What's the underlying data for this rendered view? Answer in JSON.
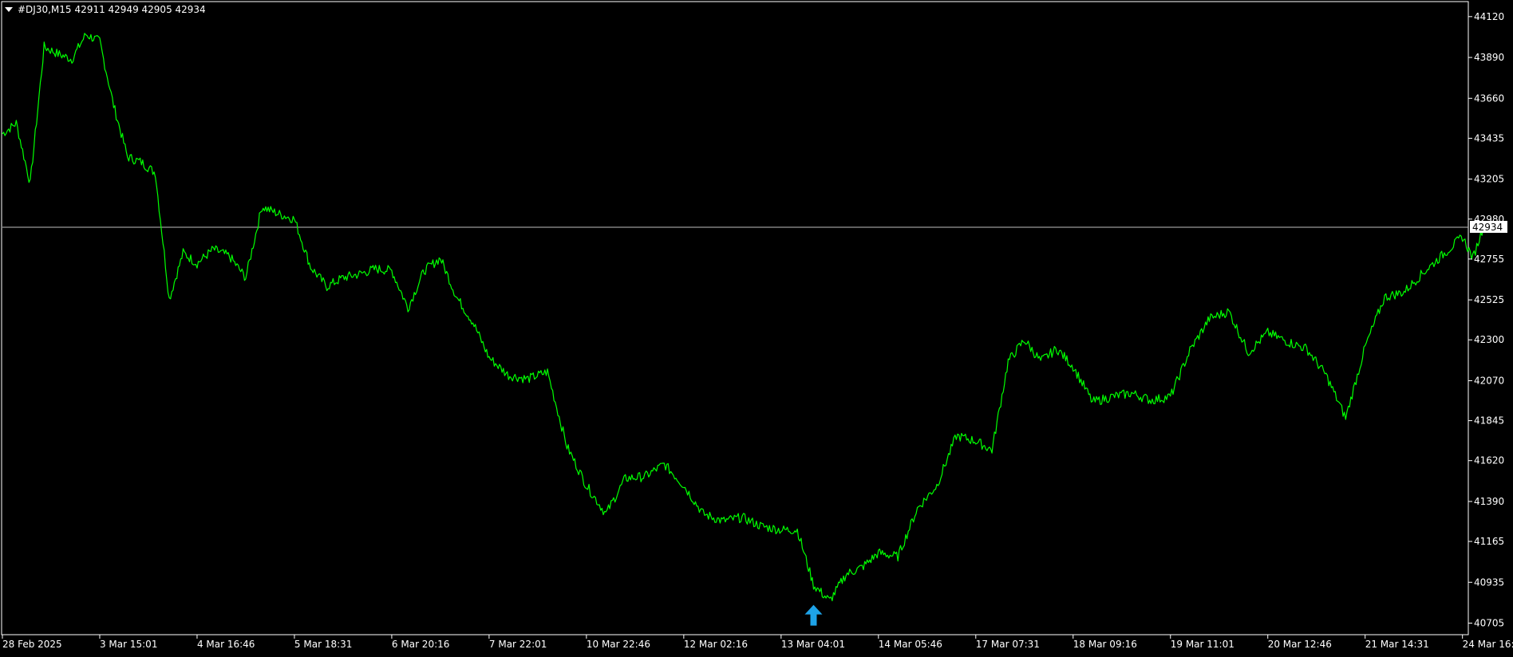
{
  "header": {
    "symbol": "#DJ30,M15",
    "ohlc": "42911 42949 42905 42934"
  },
  "price_line": {
    "value": 42934,
    "label": "42934",
    "color": "#c0c0c0"
  },
  "signal": {
    "type": "buy-arrow",
    "color": "#1ea3e8",
    "x": "13 Mar 11:30",
    "y": 40745
  },
  "colors": {
    "background": "#000000",
    "line": "#00ff00",
    "axis": "#ffffff",
    "text": "#ffffff"
  },
  "chart_data": {
    "type": "line",
    "title": "#DJ30,M15",
    "xlabel": "",
    "ylabel": "",
    "ylim": [
      40640,
      44200
    ],
    "yticks": [
      44120,
      43890,
      43660,
      43435,
      43205,
      42980,
      42755,
      42525,
      42300,
      42070,
      41845,
      41620,
      41390,
      41165,
      40935,
      40705
    ],
    "xticks": [
      "28 Feb 2025",
      "3 Mar 15:01",
      "4 Mar 16:46",
      "5 Mar 18:31",
      "6 Mar 20:16",
      "7 Mar 22:01",
      "10 Mar 22:46",
      "12 Mar 02:16",
      "13 Mar 04:01",
      "14 Mar 05:46",
      "17 Mar 07:31",
      "18 Mar 09:16",
      "19 Mar 11:01",
      "20 Mar 12:46",
      "21 Mar 14:31",
      "24 Mar 16:16"
    ],
    "grid": false,
    "series": [
      {
        "color": "#00ff00",
        "x": [
          "28 Feb 2025",
          "28 Feb 12:00",
          "28 Feb 16:00",
          "28 Feb 20:00",
          "3 Mar 04:00",
          "3 Mar 09:00",
          "3 Mar 12:00",
          "3 Mar 15:01",
          "3 Mar 19:00",
          "3 Mar 23:00",
          "4 Mar 04:00",
          "4 Mar 09:00",
          "4 Mar 12:00",
          "4 Mar 15:00",
          "4 Mar 16:46",
          "4 Mar 21:00",
          "5 Mar 02:00",
          "5 Mar 06:00",
          "5 Mar 10:00",
          "5 Mar 14:00",
          "5 Mar 18:31",
          "5 Mar 22:00",
          "6 Mar 03:00",
          "6 Mar 07:00",
          "6 Mar 11:00",
          "6 Mar 16:00",
          "6 Mar 20:16",
          "7 Mar 02:00",
          "7 Mar 06:00",
          "7 Mar 10:00",
          "7 Mar 14:00",
          "7 Mar 18:00",
          "7 Mar 22:01",
          "10 Mar 03:00",
          "10 Mar 08:00",
          "10 Mar 13:00",
          "10 Mar 18:00",
          "10 Mar 22:46",
          "11 Mar 04:00",
          "11 Mar 09:00",
          "11 Mar 14:00",
          "11 Mar 20:00",
          "12 Mar 02:16",
          "12 Mar 07:00",
          "12 Mar 12:00",
          "12 Mar 17:00",
          "12 Mar 22:00",
          "13 Mar 04:01",
          "13 Mar 08:00",
          "13 Mar 11:30",
          "13 Mar 15:00",
          "13 Mar 20:00",
          "14 Mar 01:00",
          "14 Mar 05:46",
          "14 Mar 10:00",
          "14 Mar 14:00",
          "14 Mar 18:00",
          "17 Mar 03:00",
          "17 Mar 07:31",
          "17 Mar 12:00",
          "17 Mar 16:00",
          "17 Mar 20:00",
          "18 Mar 02:00",
          "18 Mar 06:00",
          "18 Mar 09:16",
          "18 Mar 14:00",
          "18 Mar 18:00",
          "19 Mar 00:00",
          "19 Mar 05:00",
          "19 Mar 11:01",
          "19 Mar 16:00",
          "19 Mar 20:00",
          "20 Mar 02:00",
          "20 Mar 07:00",
          "20 Mar 12:46",
          "20 Mar 17:00",
          "21 Mar 00:00",
          "21 Mar 05:00",
          "21 Mar 10:00",
          "21 Mar 14:31",
          "21 Mar 19:00",
          "24 Mar 02:00",
          "24 Mar 08:00",
          "24 Mar 12:00",
          "24 Mar 16:16",
          "24 Mar 19:00",
          "24 Mar 20:30"
        ],
        "values": [
          43460,
          43520,
          43180,
          43950,
          43910,
          43880,
          44020,
          43980,
          43620,
          43330,
          43300,
          43240,
          42530,
          42790,
          42730,
          42810,
          42770,
          42650,
          43050,
          43010,
          42980,
          42710,
          42600,
          42650,
          42670,
          42700,
          42690,
          42480,
          42690,
          42760,
          42540,
          42400,
          42200,
          42100,
          42080,
          42120,
          41700,
          41480,
          41320,
          41520,
          41530,
          41600,
          41480,
          41320,
          41280,
          41300,
          41250,
          41230,
          41230,
          40920,
          40830,
          40980,
          41020,
          41100,
          41080,
          41350,
          41480,
          41760,
          41730,
          41680,
          42180,
          42300,
          42180,
          42250,
          42150,
          41950,
          41980,
          42000,
          41960,
          41980,
          42240,
          42420,
          42460,
          42230,
          42340,
          42290,
          42250,
          42100,
          41860,
          42260,
          42540,
          42570,
          42680,
          42780,
          42880,
          42760,
          42934
        ]
      }
    ]
  }
}
